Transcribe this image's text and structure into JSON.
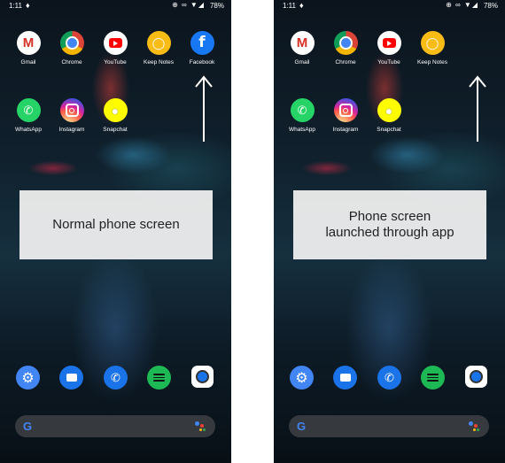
{
  "colors": {
    "overlay_bg": "#eeeeee",
    "gmail": "#d93025",
    "youtube": "#ff0000",
    "keep": "#f9bc15",
    "facebook": "#1877f2",
    "whatsapp": "#25d366",
    "snapchat": "#fffc00",
    "settings": "#4285f4",
    "spotify": "#1db954"
  },
  "status": {
    "time": "1:11",
    "battery": "78%"
  },
  "apps": {
    "gmail": "Gmail",
    "chrome": "Chrome",
    "youtube": "YouTube",
    "keep": "Keep Notes",
    "facebook": "Facebook",
    "whatsapp": "WhatsApp",
    "instagram": "Instagram",
    "snapchat": "Snapchat"
  },
  "dock": [
    "settings-icon",
    "messages-icon",
    "phone-icon",
    "spotify-icon",
    "camera-icon"
  ],
  "left_panel": {
    "caption": "Normal phone screen",
    "has_facebook": true
  },
  "right_panel": {
    "caption_line1": "Phone screen",
    "caption_line2": "launched through app",
    "has_facebook": false
  },
  "search": {
    "logo": "G"
  }
}
